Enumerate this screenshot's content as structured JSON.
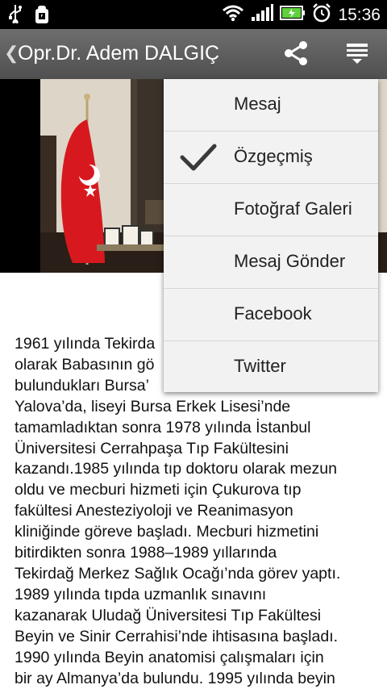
{
  "status_bar": {
    "time": "15:36",
    "icons": [
      "usb-icon",
      "debug-icon",
      "wifi-icon",
      "signal-icon",
      "battery-icon",
      "alarm-icon"
    ]
  },
  "action_bar": {
    "title": "Opr.Dr. Adem DALGIÇ",
    "icons": [
      "back-chevron-icon",
      "share-icon",
      "menu-icon"
    ]
  },
  "menu": {
    "items": [
      {
        "label": "Mesaj",
        "checked": false
      },
      {
        "label": "Özgeçmiş",
        "checked": true
      },
      {
        "label": "Fotoğraf Galeri",
        "checked": false
      },
      {
        "label": "Mesaj Gönder",
        "checked": false
      },
      {
        "label": "Facebook",
        "checked": false
      },
      {
        "label": "Twitter",
        "checked": false
      }
    ]
  },
  "bio": {
    "lines": [
      "1961 yılında Tekirda",
      "olarak Babasının gö",
      "bulundukları Bursa’",
      "Yalova’da, liseyi Bursa Erkek Lisesi’nde",
      "tamamladıktan sonra 1978 yılında İstanbul",
      "Üniversitesi Cerrahpaşa Tıp Fakültesini",
      "kazandı.1985 yılında tıp doktoru olarak mezun",
      "oldu ve mecburi hizmeti için Çukurova tıp",
      "fakültesi Anesteziyoloji ve Reanimasyon",
      "kliniğinde göreve başladı. Mecburi hizmetini",
      "bitirdikten sonra 1988–1989 yıllarında",
      "Tekirdağ Merkez Sağlık Ocağı’nda görev yaptı.",
      "1989 yılında tıpda uzmanlık sınavını",
      "kazanarak Uludağ Üniversitesi Tıp Fakültesi",
      "Beyin ve Sinir Cerrahisi’nde ihtisasına başladı.",
      "1990 yılında Beyin anatomisi çalışmaları için",
      "bir ay Almanya’da bulundu. 1995 yılında beyin"
    ]
  },
  "colors": {
    "action_bar": "#5c5c5c",
    "menu_bg": "#f2f2f2",
    "flag_red": "#d7191f",
    "battery_green": "#5fd13b"
  }
}
